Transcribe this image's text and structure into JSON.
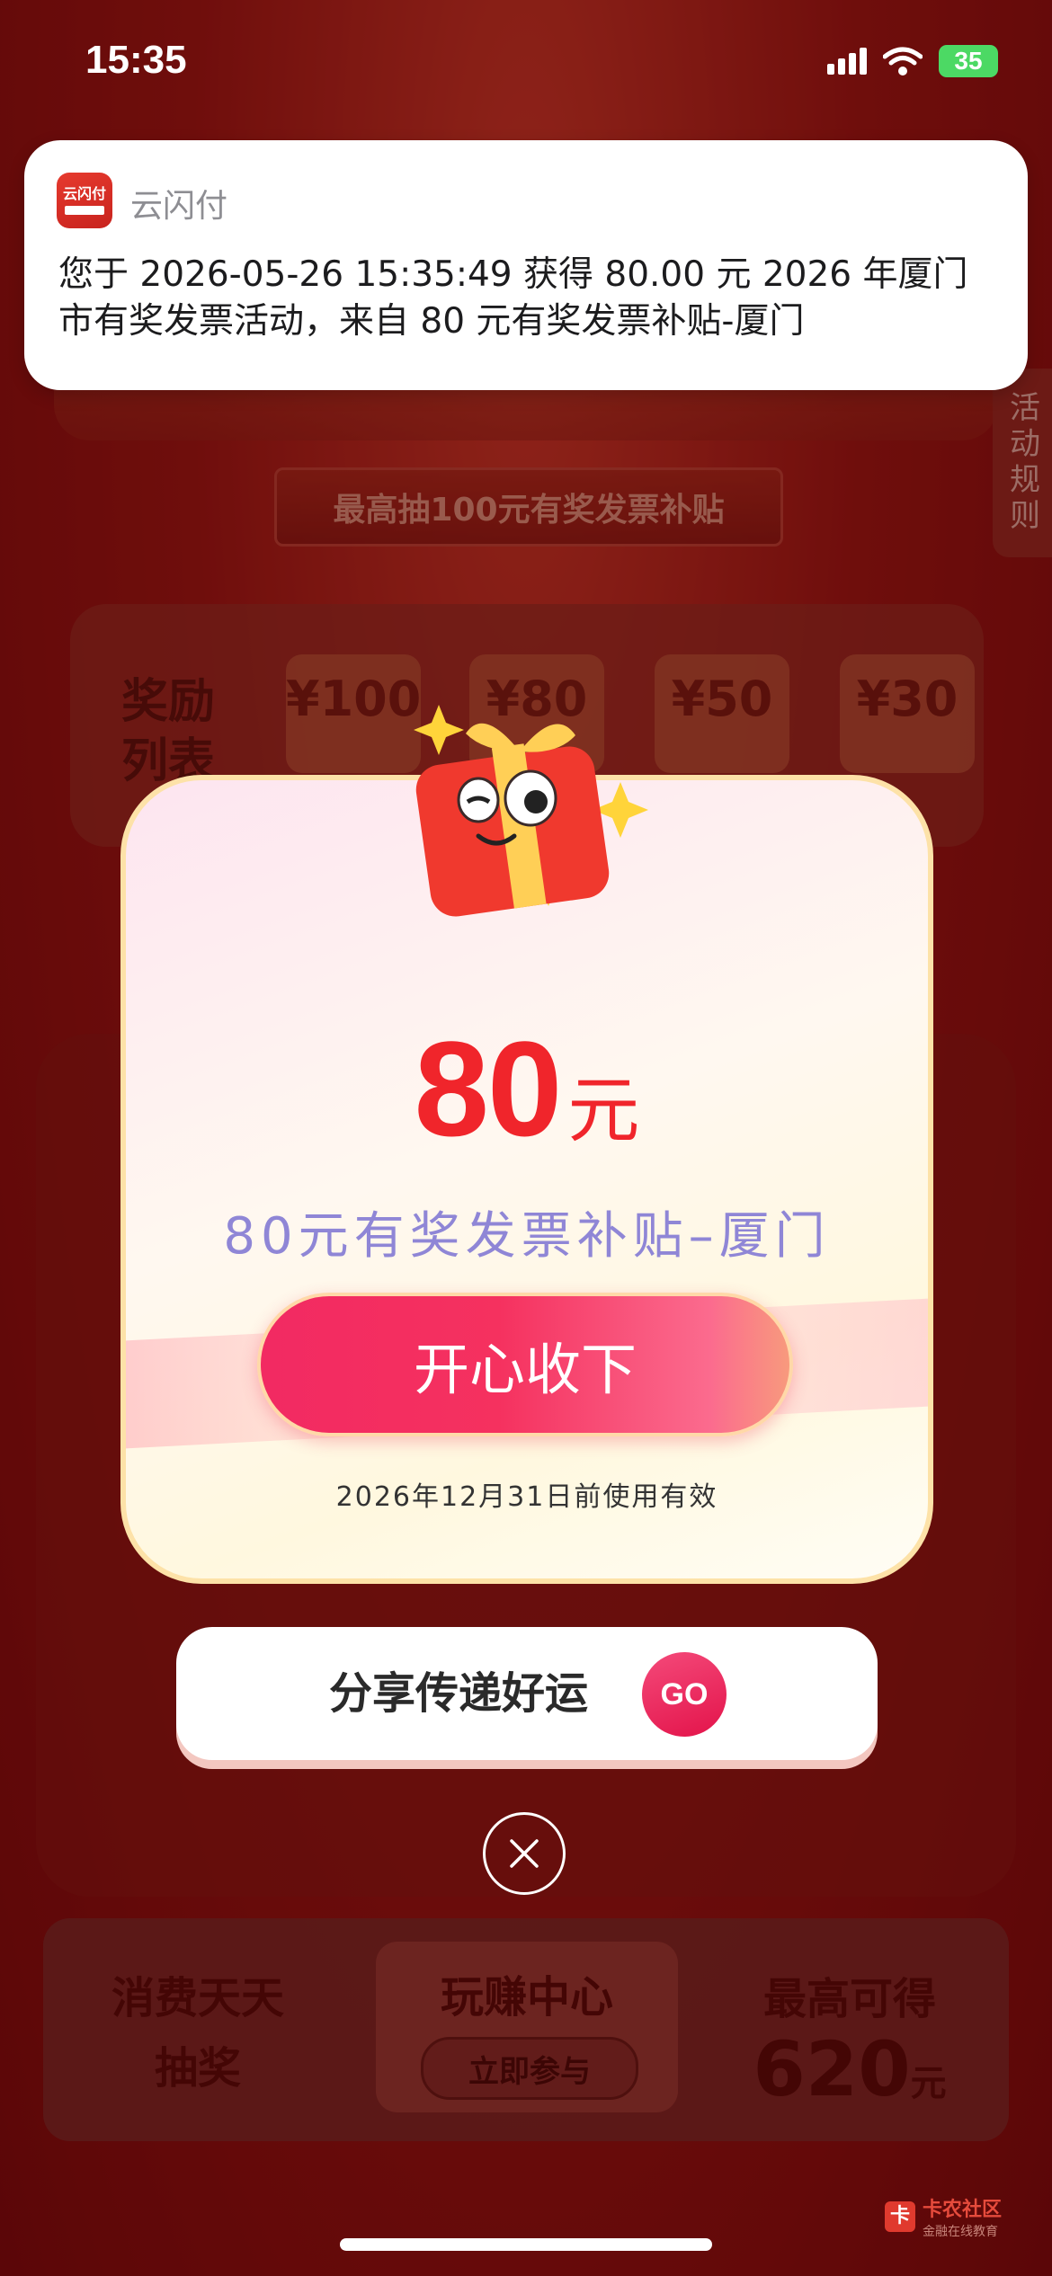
{
  "status_bar": {
    "time": "15:35",
    "battery": "35"
  },
  "notification": {
    "app_name": "云闪付",
    "app_icon_text": "云闪付",
    "body": "您于 2026-05-26 15:35:49 获得 80.00 元 2026 年厦门市有奖发票活动，来自 80 元有奖发票补贴-厦门"
  },
  "background": {
    "subtitle": "最高抽100元有奖发票补贴",
    "rules_tab": "活动规则",
    "reward_label": "奖励列表",
    "prizes": [
      "¥100",
      "¥80",
      "¥50",
      "¥30"
    ],
    "bottom_left": "消费天天抽奖",
    "bottom_mid_title": "玩赚中心",
    "bottom_mid_button": "立即参与",
    "bottom_right_title": "最高可得",
    "bottom_right_value": "620",
    "bottom_right_unit": "元"
  },
  "popup": {
    "amount": "80",
    "amount_unit": "元",
    "name": "80元有奖发票补贴–厦门",
    "accept_label": "开心收下",
    "valid_until": "2026年12月31日前使用有效"
  },
  "share": {
    "label": "分享传递好运",
    "go_label": "GO"
  },
  "watermark": {
    "title": "卡农社区",
    "subtitle": "金融在线教育"
  },
  "colors": {
    "accent": "#f0252b",
    "button": "#f22a62",
    "subtitle": "#8f86d6"
  }
}
